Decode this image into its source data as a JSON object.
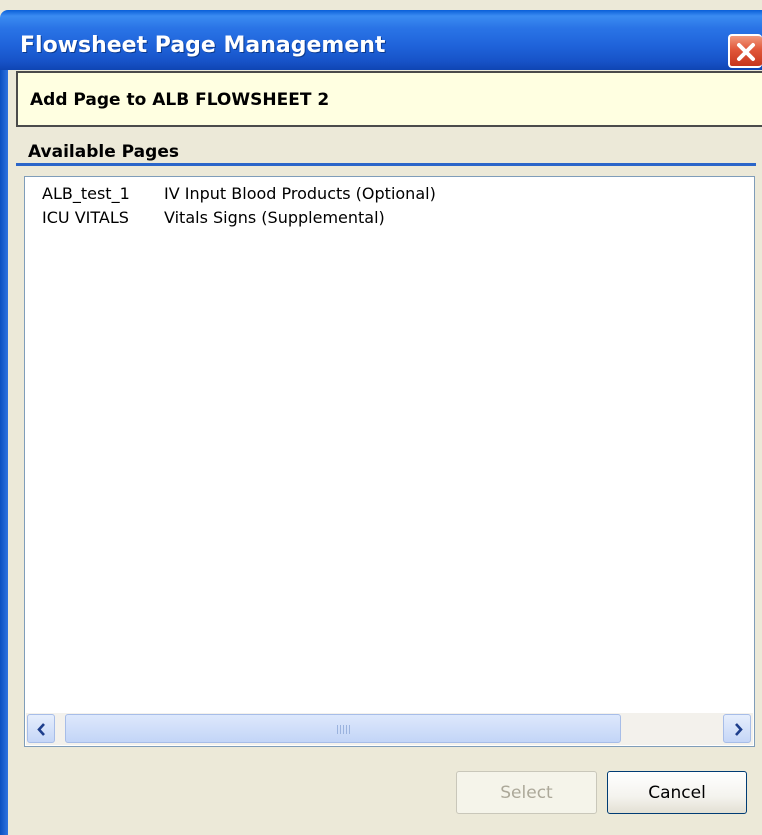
{
  "window": {
    "title": "Flowsheet Page Management"
  },
  "heading": "Add Page to ALB FLOWSHEET 2",
  "available_pages": {
    "label": "Available Pages",
    "items": [
      {
        "code": "ALB_test_1",
        "description": "IV Input Blood Products (Optional)"
      },
      {
        "code": "ICU VITALS",
        "description": "Vitals Signs (Supplemental)"
      }
    ]
  },
  "buttons": {
    "select": "Select",
    "cancel": "Cancel"
  }
}
